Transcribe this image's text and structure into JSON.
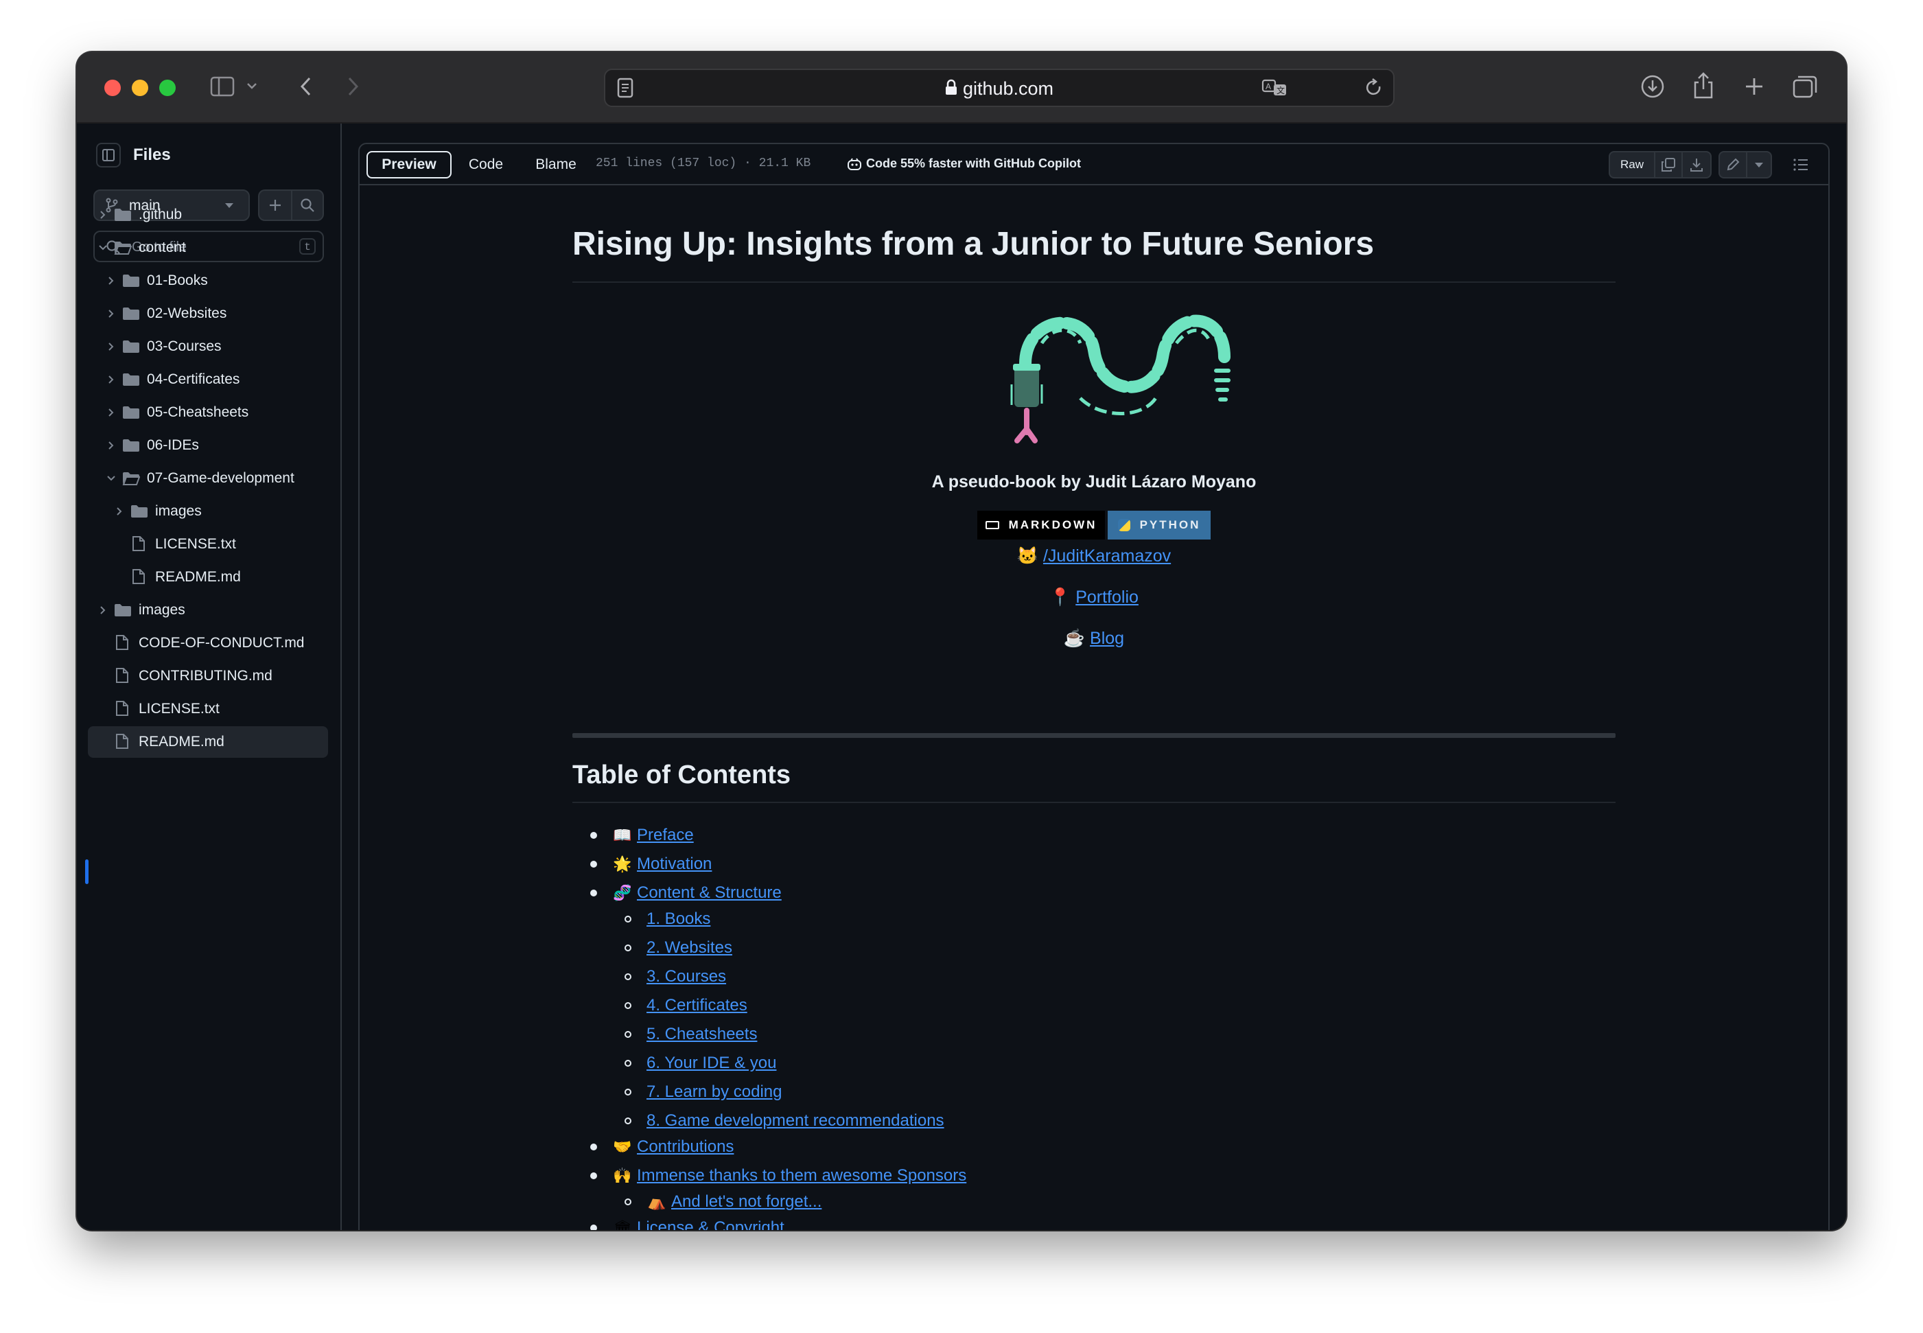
{
  "browser": {
    "host": "github.com"
  },
  "sidebar": {
    "title": "Files",
    "branch": "main",
    "search_placeholder": "Go to file",
    "search_shortcut": "t",
    "tree": [
      {
        "label": ".github",
        "type": "folder",
        "depth": 0,
        "state": "collapsed"
      },
      {
        "label": "content",
        "type": "folder",
        "depth": 0,
        "state": "expanded"
      },
      {
        "label": "01-Books",
        "type": "folder",
        "depth": 1,
        "state": "collapsed"
      },
      {
        "label": "02-Websites",
        "type": "folder",
        "depth": 1,
        "state": "collapsed"
      },
      {
        "label": "03-Courses",
        "type": "folder",
        "depth": 1,
        "state": "collapsed"
      },
      {
        "label": "04-Certificates",
        "type": "folder",
        "depth": 1,
        "state": "collapsed"
      },
      {
        "label": "05-Cheatsheets",
        "type": "folder",
        "depth": 1,
        "state": "collapsed"
      },
      {
        "label": "06-IDEs",
        "type": "folder",
        "depth": 1,
        "state": "collapsed"
      },
      {
        "label": "07-Game-development",
        "type": "folder",
        "depth": 1,
        "state": "expanded"
      },
      {
        "label": "images",
        "type": "folder",
        "depth": 2,
        "state": "collapsed"
      },
      {
        "label": "LICENSE.txt",
        "type": "file",
        "depth": 2
      },
      {
        "label": "README.md",
        "type": "file",
        "depth": 2
      },
      {
        "label": "images",
        "type": "folder",
        "depth": 0,
        "state": "collapsed"
      },
      {
        "label": "CODE-OF-CONDUCT.md",
        "type": "file",
        "depth": 0
      },
      {
        "label": "CONTRIBUTING.md",
        "type": "file",
        "depth": 0
      },
      {
        "label": "LICENSE.txt",
        "type": "file",
        "depth": 0
      },
      {
        "label": "README.md",
        "type": "file",
        "depth": 0,
        "selected": true
      }
    ]
  },
  "toolbar": {
    "tabs": [
      "Preview",
      "Code",
      "Blame"
    ],
    "active_tab": "Preview",
    "file_meta": "251 lines (157 loc) · 21.1 KB",
    "copilot_text": "Code 55% faster with GitHub Copilot",
    "raw_label": "Raw"
  },
  "readme": {
    "title": "Rising Up: Insights from a Junior to Future Seniors",
    "subtitle": "A pseudo-book by Judit Lázaro Moyano",
    "badges": [
      {
        "label": "MARKDOWN",
        "bg": "#000000"
      },
      {
        "label": "PYTHON",
        "bg": "#3670a0"
      }
    ],
    "links": [
      {
        "emoji": "🐱",
        "label": "/JuditKaramazov"
      },
      {
        "emoji": "📍",
        "label": "Portfolio"
      },
      {
        "emoji": "☕",
        "label": "Blog"
      }
    ],
    "toc_heading": "Table of Contents",
    "toc": [
      {
        "level": 0,
        "emoji": "📖",
        "label": "Preface"
      },
      {
        "level": 0,
        "emoji": "🌟",
        "label": "Motivation"
      },
      {
        "level": 0,
        "emoji": "🧬",
        "label": "Content & Structure"
      },
      {
        "level": 1,
        "emoji": "",
        "label": "1. Books"
      },
      {
        "level": 1,
        "emoji": "",
        "label": "2. Websites"
      },
      {
        "level": 1,
        "emoji": "",
        "label": "3. Courses"
      },
      {
        "level": 1,
        "emoji": "",
        "label": "4. Certificates"
      },
      {
        "level": 1,
        "emoji": "",
        "label": "5. Cheatsheets"
      },
      {
        "level": 1,
        "emoji": "",
        "label": "6. Your IDE & you"
      },
      {
        "level": 1,
        "emoji": "",
        "label": "7. Learn by coding"
      },
      {
        "level": 1,
        "emoji": "",
        "label": "8. Game development recommendations"
      },
      {
        "level": 0,
        "emoji": "🤝",
        "label": "Contributions"
      },
      {
        "level": 0,
        "emoji": "🙌",
        "label": "Immense thanks to them awesome Sponsors"
      },
      {
        "level": 1,
        "emoji": "⛺",
        "label": "And let's not forget..."
      },
      {
        "level": 0,
        "emoji": "🏛",
        "label": "License & Copyright"
      }
    ]
  },
  "colors": {
    "link": "#4493f8",
    "bg": "#0d1117",
    "accent_selected": "#1f6feb",
    "logo_green": "#6fe3c0",
    "logo_pink": "#e07ab0"
  }
}
